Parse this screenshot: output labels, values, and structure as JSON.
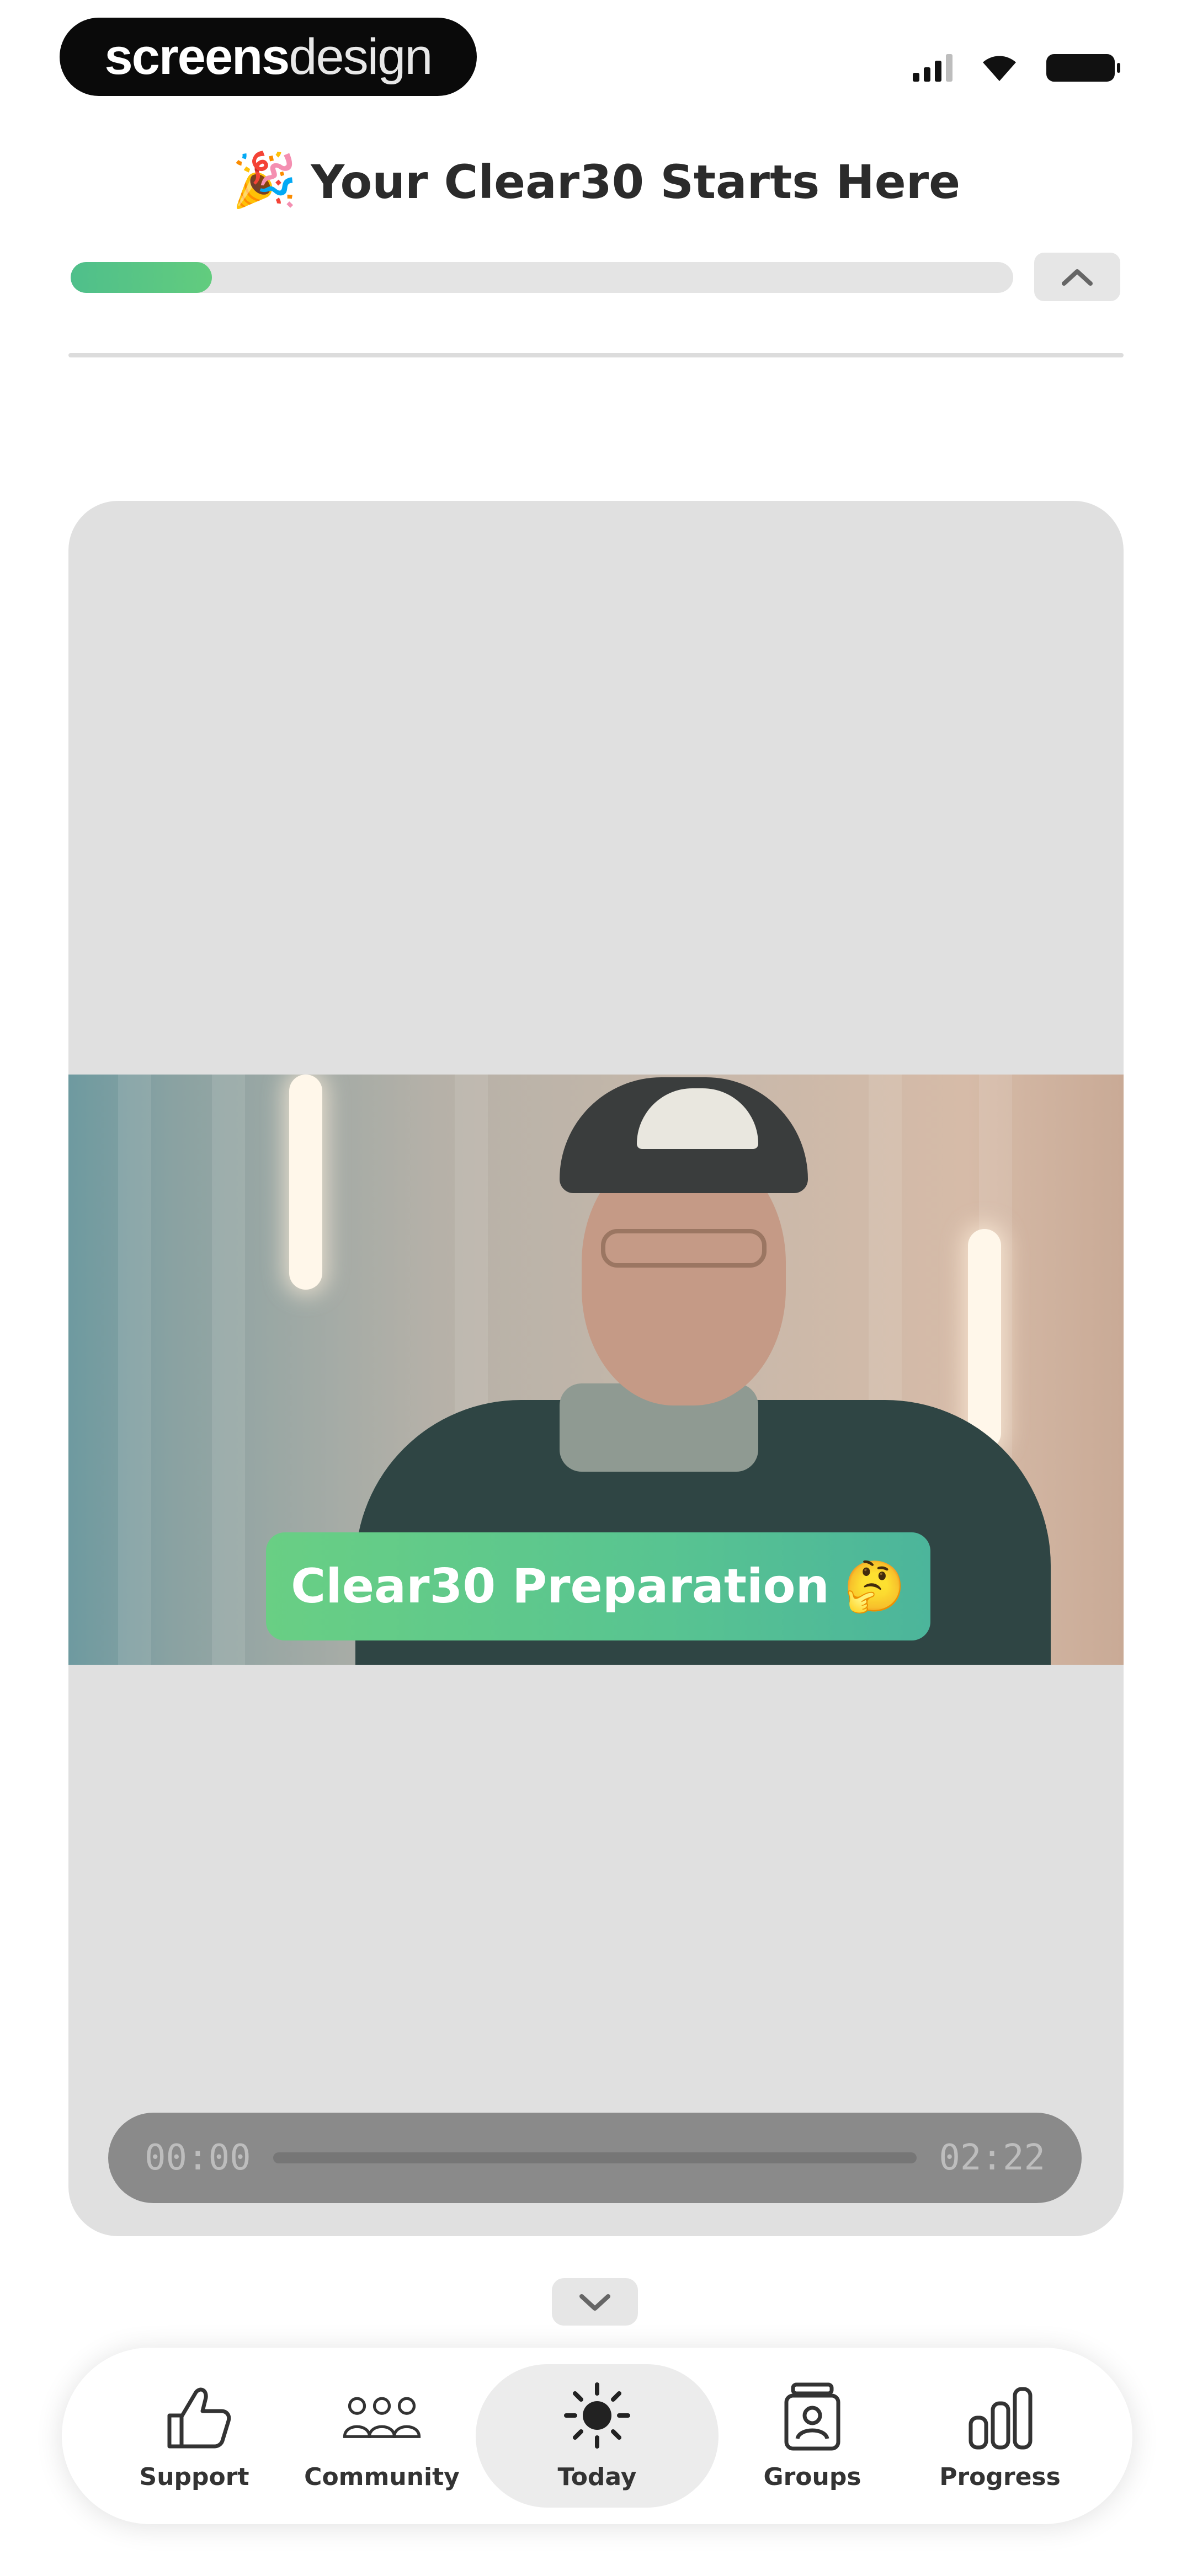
{
  "status_bar": {
    "watermark_strong": "screens",
    "watermark_light": "design",
    "icons": [
      "signal-icon",
      "wifi-icon",
      "battery-icon"
    ]
  },
  "header": {
    "title_emoji": "🎉",
    "title": "Your Clear30 Starts Here",
    "progress": 0.15,
    "collapse_icon": "chevron-up-icon"
  },
  "video": {
    "chip_label": "Clear30 Preparation",
    "chip_emoji": "🤔",
    "time_current": "00:00",
    "time_total": "02:22"
  },
  "expand_icon": "chevron-down-icon",
  "tab_bar": {
    "tabs": [
      {
        "label": "Support",
        "icon": "thumbs-up-icon",
        "active": false
      },
      {
        "label": "Community",
        "icon": "community-icon",
        "active": false
      },
      {
        "label": "Today",
        "icon": "sun-icon",
        "active": true
      },
      {
        "label": "Groups",
        "icon": "groups-icon",
        "active": false
      },
      {
        "label": "Progress",
        "icon": "bar-chart-icon",
        "active": false
      }
    ]
  },
  "colors": {
    "accent_green": "#5bc48c",
    "card_bg": "#e0e0e0",
    "active_tab_bg": "#ececec"
  }
}
